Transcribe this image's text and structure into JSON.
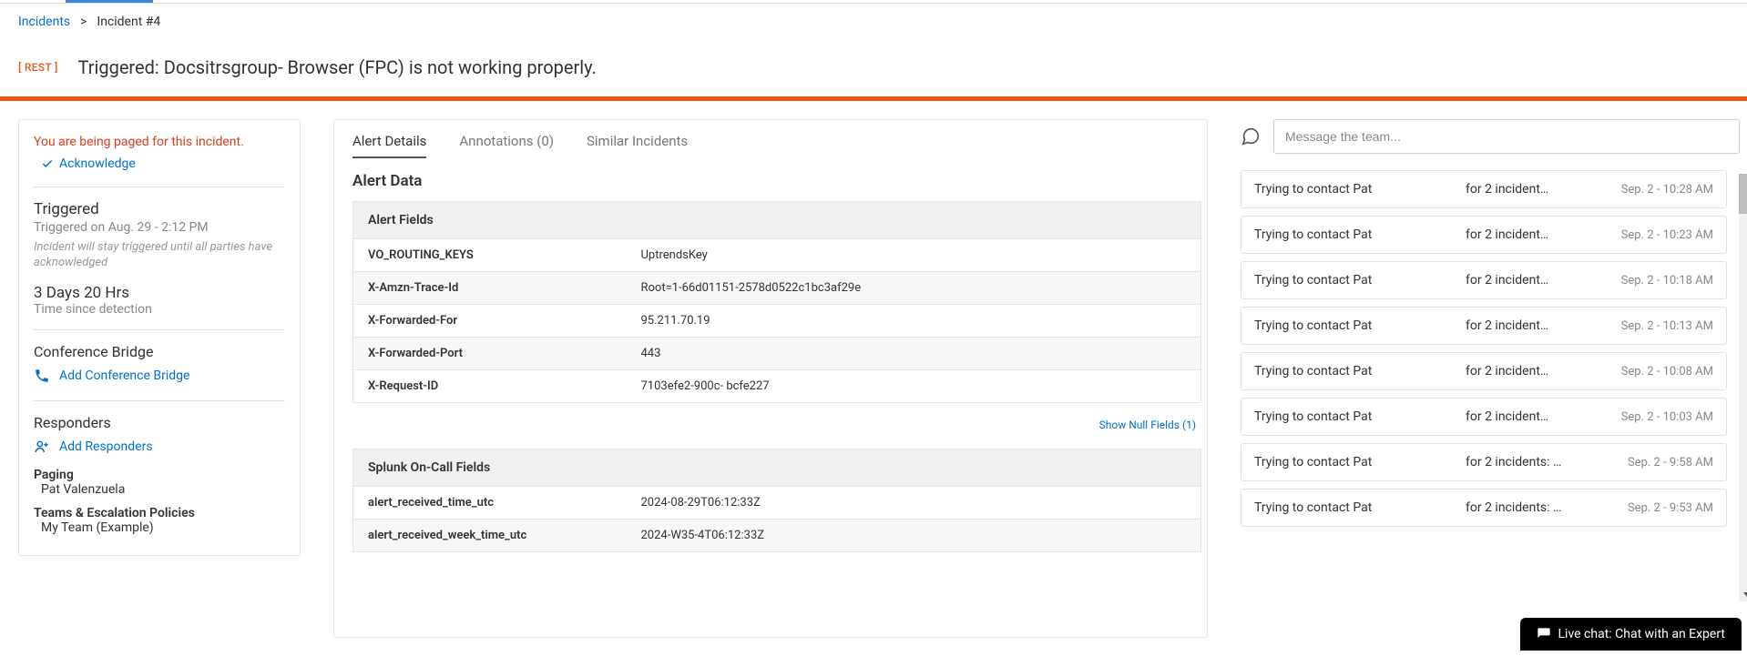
{
  "breadcrumb": {
    "root": "Incidents",
    "current": "Incident #4"
  },
  "header": {
    "rest_badge": "[ REST ]",
    "title": "Triggered: Docsitrsgroup- Browser (FPC) is not working properly."
  },
  "left": {
    "paged_text": "You are being paged for this incident.",
    "ack_label": "Acknowledge",
    "triggered_head": "Triggered",
    "triggered_sub": "Triggered on Aug. 29 - 2:12 PM",
    "triggered_note": "Incident will stay triggered until all parties have acknowledged",
    "duration": "3 Days 20 Hrs",
    "duration_sub": "Time since detection",
    "conf_head": "Conference Bridge",
    "add_conf": "Add Conference Bridge",
    "resp_head": "Responders",
    "add_resp": "Add Responders",
    "paging_label": "Paging",
    "paging_value": "Pat Valenzuela",
    "teams_label": "Teams & Escalation Policies",
    "teams_value": "My Team (Example)"
  },
  "tabs": {
    "alert_details": "Alert Details",
    "annotations": "Annotations (0)",
    "similar": "Similar Incidents"
  },
  "center": {
    "alert_data_head": "Alert Data",
    "alert_fields_head": "Alert Fields",
    "alert_fields": [
      {
        "k": "VO_ROUTING_KEYS",
        "v": "UptrendsKey"
      },
      {
        "k": "X-Amzn-Trace-Id",
        "v": "Root=1-66d01151-2578d0522c1bc3af29e"
      },
      {
        "k": "X-Forwarded-For",
        "v": "95.211.70.19"
      },
      {
        "k": "X-Forwarded-Port",
        "v": "443"
      },
      {
        "k": "X-Request-ID",
        "v": "7103efe2-900c-                                          bcfe227"
      }
    ],
    "show_null": "Show Null Fields (1)",
    "splunk_head": "Splunk On-Call Fields",
    "splunk_fields": [
      {
        "k": "alert_received_time_utc",
        "v": "2024-08-29T06:12:33Z"
      },
      {
        "k": "alert_received_week_time_utc",
        "v": "2024-W35-4T06:12:33Z"
      }
    ]
  },
  "right": {
    "msg_placeholder": "Message the team...",
    "log": [
      {
        "who": "Trying to contact Pat",
        "what": "for 2 incident…",
        "when": "Sep. 2 - 10:28 AM"
      },
      {
        "who": "Trying to contact Pat",
        "what": "for 2 incident…",
        "when": "Sep. 2 - 10:23 AM"
      },
      {
        "who": "Trying to contact Pat",
        "what": "for 2 incident…",
        "when": "Sep. 2 - 10:18 AM"
      },
      {
        "who": "Trying to contact Pat",
        "what": "for 2 incident…",
        "when": "Sep. 2 - 10:13 AM"
      },
      {
        "who": "Trying to contact Pat",
        "what": "for 2 incident…",
        "when": "Sep. 2 - 10:08 AM"
      },
      {
        "who": "Trying to contact Pat",
        "what": "for 2 incident…",
        "when": "Sep. 2 - 10:03 AM"
      },
      {
        "who": "Trying to contact Pat",
        "what": "for 2 incidents: …",
        "when": "Sep. 2 - 9:58 AM"
      },
      {
        "who": "Trying to contact Pat",
        "what": "for 2 incidents: …",
        "when": "Sep. 2 - 9:53 AM"
      }
    ]
  },
  "chat_expert": "Live chat: Chat with an Expert"
}
